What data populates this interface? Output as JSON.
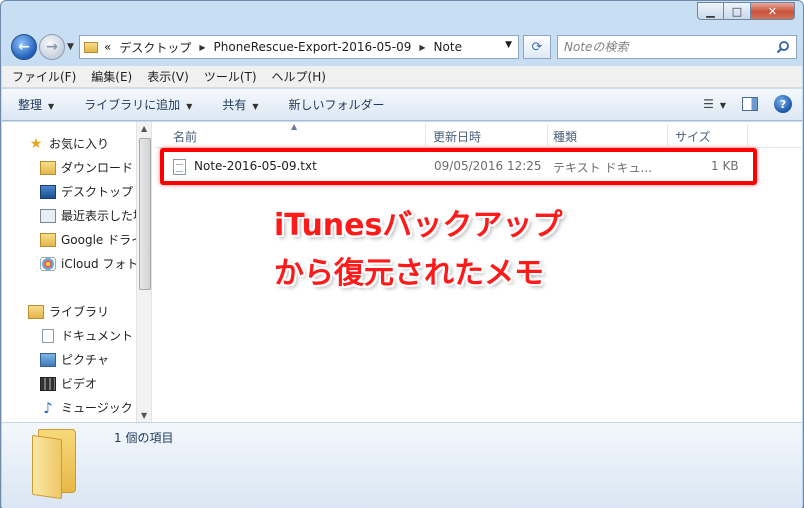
{
  "address": {
    "overflow": "«",
    "segments": [
      "デスクトップ",
      "PhoneRescue-Export-2016-05-09",
      "Note"
    ]
  },
  "search": {
    "placeholder": "Noteの検索"
  },
  "menu": [
    "ファイル(F)",
    "編集(E)",
    "表示(V)",
    "ツール(T)",
    "ヘルプ(H)"
  ],
  "toolbar": [
    "整理",
    "ライブラリに追加",
    "共有",
    "新しいフォルダー"
  ],
  "nav": {
    "favorites": {
      "header": "お気に入り",
      "items": [
        "ダウンロード",
        "デスクトップ",
        "最近表示した場",
        "Google ドライ",
        "iCloud フォト"
      ]
    },
    "libraries": {
      "header": "ライブラリ",
      "items": [
        "ドキュメント",
        "ピクチャ",
        "ビデオ",
        "ミュージック"
      ]
    }
  },
  "columns": {
    "name": "名前",
    "date": "更新日時",
    "type": "種類",
    "size": "サイズ"
  },
  "files": [
    {
      "name": "Note-2016-05-09.txt",
      "date": "09/05/2016 12:25",
      "type": "テキスト ドキュ...",
      "size": "1 KB"
    }
  ],
  "annotation": {
    "line1": "iTunesバックアップ",
    "line2": "から復元されたメモ"
  },
  "status": {
    "item_count": "1 個の項目"
  },
  "colors": {
    "highlight": "#ff0000",
    "annotation_text": "#ff1a1a"
  }
}
